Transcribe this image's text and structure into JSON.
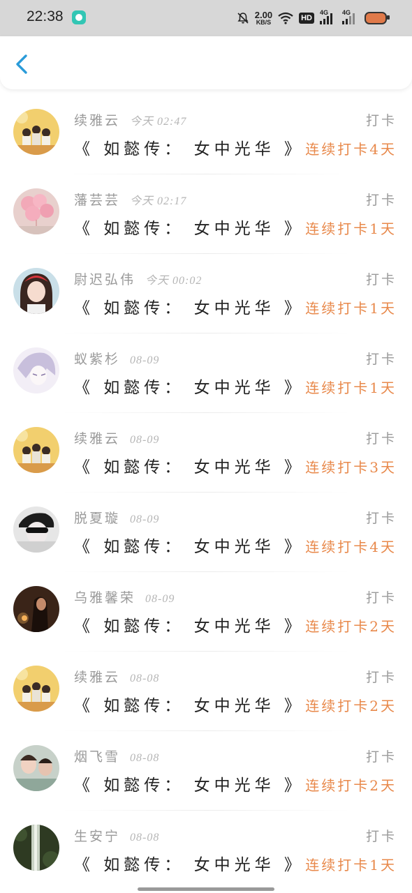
{
  "status_bar": {
    "time": "22:38",
    "net_speed_value": "2.00",
    "net_speed_unit": "KB/S",
    "hd_label": "HD",
    "sig1_label": "4G",
    "sig2_label": "4G"
  },
  "topbar": {
    "back_icon": "chevron-left-icon",
    "accent": "#2a9bd9"
  },
  "colors": {
    "name": "#9a9a9a",
    "time": "#b5b5b5",
    "streak": "#e8884a",
    "book": "#222222"
  },
  "entries": [
    {
      "name": "续雅云",
      "time": "今天 02:47",
      "action": "打卡",
      "book": "《 如懿传： 女中光华 》",
      "streak": "连续打卡4天"
    },
    {
      "name": "藩芸芸",
      "time": "今天 02:17",
      "action": "打卡",
      "book": "《 如懿传： 女中光华 》",
      "streak": "连续打卡1天"
    },
    {
      "name": "尉迟弘伟",
      "time": "今天 00:02",
      "action": "打卡",
      "book": "《 如懿传： 女中光华 》",
      "streak": "连续打卡1天"
    },
    {
      "name": "蚁紫杉",
      "time": "08-09",
      "action": "打卡",
      "book": "《 如懿传： 女中光华 》",
      "streak": "连续打卡1天"
    },
    {
      "name": "续雅云",
      "time": "08-09",
      "action": "打卡",
      "book": "《 如懿传： 女中光华 》",
      "streak": "连续打卡3天"
    },
    {
      "name": "脱夏璇",
      "time": "08-09",
      "action": "打卡",
      "book": "《 如懿传： 女中光华 》",
      "streak": "连续打卡4天"
    },
    {
      "name": "乌雅馨荣",
      "time": "08-09",
      "action": "打卡",
      "book": "《 如懿传： 女中光华 》",
      "streak": "连续打卡2天"
    },
    {
      "name": "续雅云",
      "time": "08-08",
      "action": "打卡",
      "book": "《 如懿传： 女中光华 》",
      "streak": "连续打卡2天"
    },
    {
      "name": "烟飞雪",
      "time": "08-08",
      "action": "打卡",
      "book": "《 如懿传： 女中光华 》",
      "streak": "连续打卡2天"
    },
    {
      "name": "生安宁",
      "time": "08-08",
      "action": "打卡",
      "book": "《 如懿传： 女中光华 》",
      "streak": "连续打卡1天"
    }
  ]
}
